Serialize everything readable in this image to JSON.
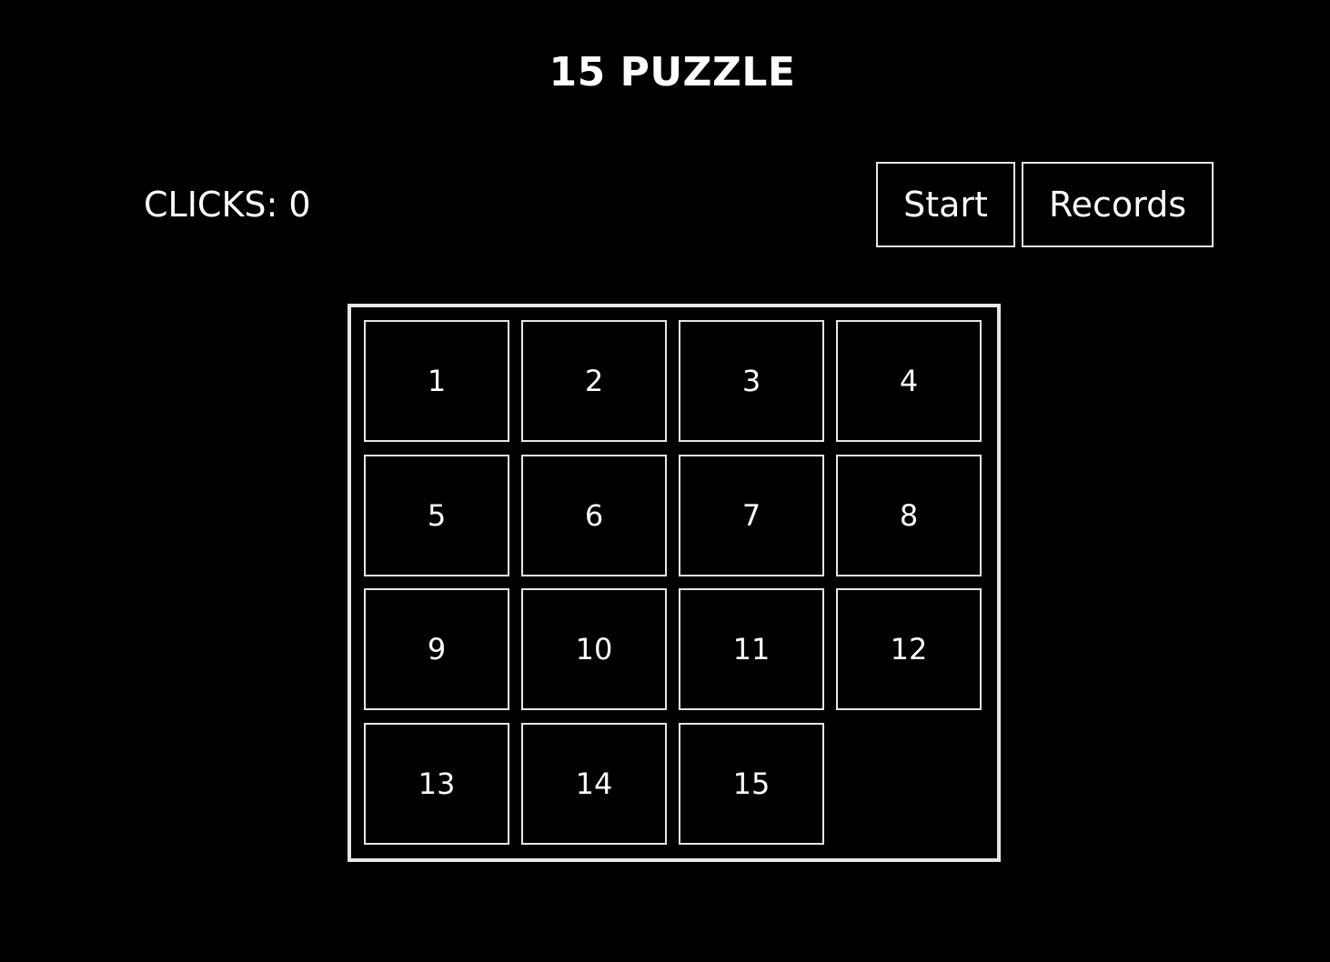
{
  "header": {
    "title": "15 PUZZLE"
  },
  "status": {
    "clicks_text": "CLICKS: 0"
  },
  "controls": {
    "start_label": "Start",
    "records_label": "Records"
  },
  "board": {
    "rows": 4,
    "cols": 4,
    "tiles": [
      "1",
      "2",
      "3",
      "4",
      "5",
      "6",
      "7",
      "8",
      "9",
      "10",
      "11",
      "12",
      "13",
      "14",
      "15",
      ""
    ]
  },
  "colors": {
    "background": "#000000",
    "foreground": "#ffffff",
    "border": "#e6e6e6"
  }
}
